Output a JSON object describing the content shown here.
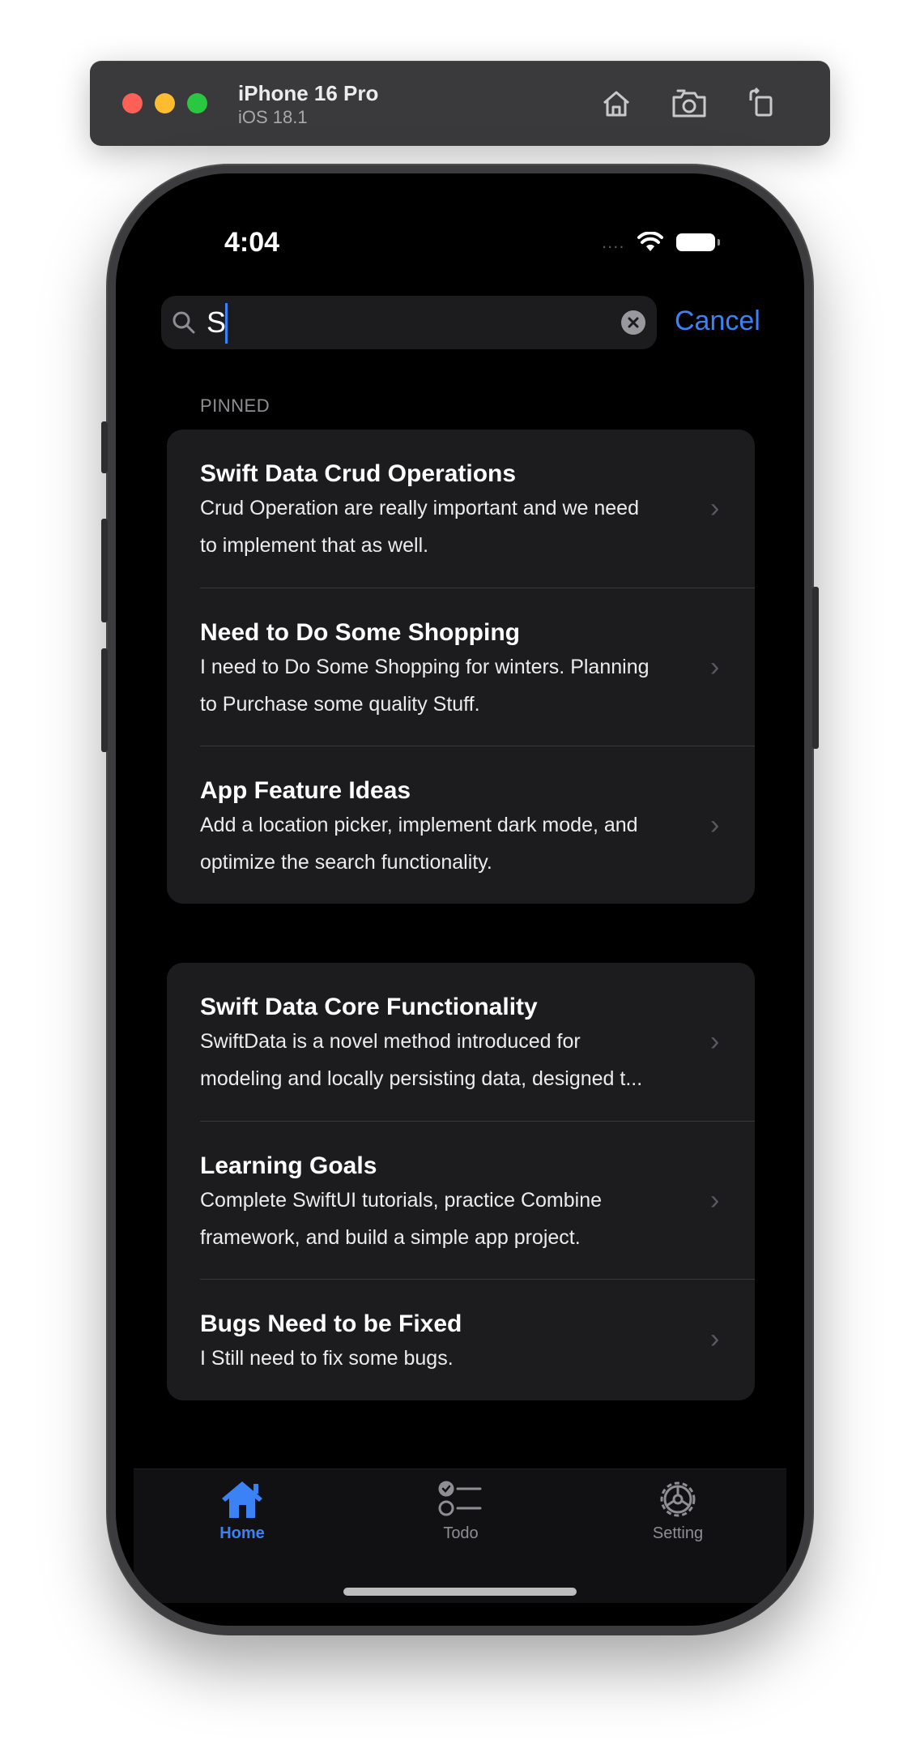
{
  "simulator": {
    "device_name": "iPhone 16 Pro",
    "os_version": "iOS 18.1",
    "buttons": [
      "home-icon",
      "screenshot-icon",
      "rotate-icon"
    ]
  },
  "status_bar": {
    "time": "4:04",
    "signal_text": "...."
  },
  "search": {
    "value": "S",
    "cancel_label": "Cancel"
  },
  "pinned_section": {
    "header": "PINNED",
    "notes": [
      {
        "title": "Swift Data Crud Operations",
        "line1": "Crud Operation are really important and we need",
        "line2": "to implement that as well."
      },
      {
        "title": "Need to Do Some Shopping",
        "line1": "I need to Do Some Shopping for winters. Planning",
        "line2": "to Purchase some quality Stuff."
      },
      {
        "title": "App Feature Ideas",
        "line1": "Add a location picker, implement dark mode, and",
        "line2": "optimize the search functionality."
      }
    ]
  },
  "other_section": {
    "notes": [
      {
        "title": "Swift Data Core Functionality",
        "line1": "SwiftData is a novel method introduced for",
        "line2": "modeling and locally persisting data, designed t..."
      },
      {
        "title": "Learning Goals",
        "line1": "Complete SwiftUI tutorials, practice Combine",
        "line2": "framework, and build a simple app project."
      },
      {
        "title": "Bugs Need to be Fixed",
        "line1": "I Still need to fix some bugs."
      }
    ]
  },
  "tab_bar": {
    "tabs": [
      {
        "label": "Home",
        "icon": "house-icon",
        "selected": true
      },
      {
        "label": "Todo",
        "icon": "checklist-icon",
        "selected": false
      },
      {
        "label": "Setting",
        "icon": "gear-icon",
        "selected": false
      }
    ]
  },
  "colors": {
    "accent": "#3b82f6",
    "card_bg": "#1c1c1e",
    "screen_bg": "#000000",
    "inactive_tab": "#8e8e93"
  }
}
